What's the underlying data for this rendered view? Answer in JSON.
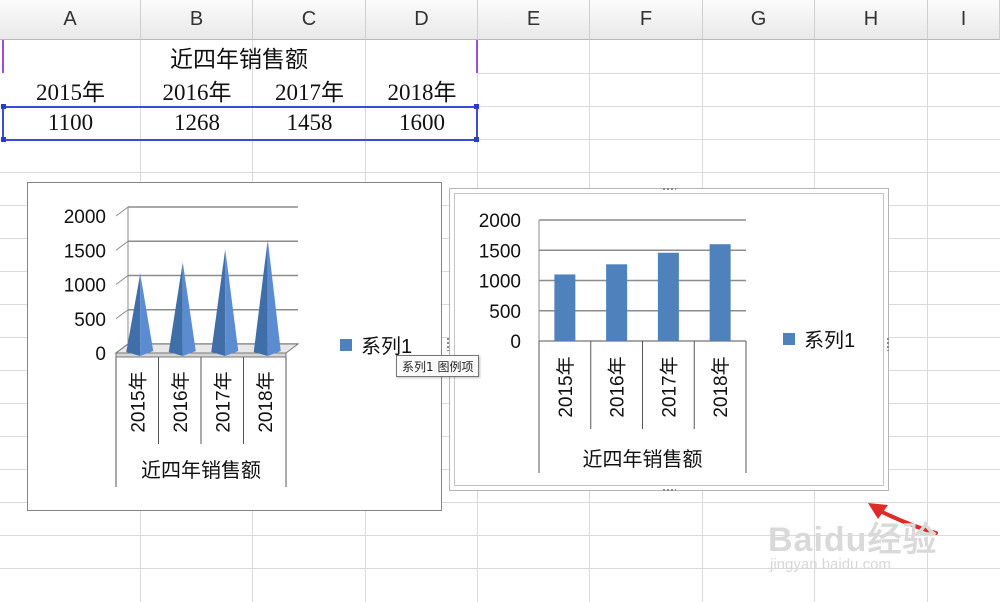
{
  "spreadsheet": {
    "columns": [
      "A",
      "B",
      "C",
      "D",
      "E",
      "F",
      "G",
      "H",
      "I"
    ],
    "table": {
      "title": "近四年销售额",
      "years": [
        "2015年",
        "2016年",
        "2017年",
        "2018年"
      ],
      "values": [
        "1100",
        "1268",
        "1458",
        "1600"
      ]
    },
    "selection_color": "#3a4bd6"
  },
  "chart_data": [
    {
      "type": "bar",
      "style": "3d-cone",
      "categories": [
        "2015年",
        "2016年",
        "2017年",
        "2018年"
      ],
      "category_group_label": "近四年销售额",
      "series": [
        {
          "name": "系列1",
          "values": [
            1100,
            1268,
            1458,
            1600
          ]
        }
      ],
      "y_ticks": [
        "2000",
        "1500",
        "1000",
        "500",
        "0"
      ],
      "ylim": [
        0,
        2000
      ],
      "grid": true,
      "legend": "right",
      "color": "#4f81bd"
    },
    {
      "type": "bar",
      "style": "clustered-column",
      "categories": [
        "2015年",
        "2016年",
        "2017年",
        "2018年"
      ],
      "category_group_label": "近四年销售额",
      "series": [
        {
          "name": "系列1",
          "values": [
            1100,
            1268,
            1458,
            1600
          ]
        }
      ],
      "y_ticks": [
        "2000",
        "1500",
        "1000",
        "500",
        "0"
      ],
      "ylim": [
        0,
        2000
      ],
      "grid": true,
      "legend": "right",
      "color": "#4f81bd"
    }
  ],
  "tooltip": {
    "text": "系列1 图例项"
  },
  "watermark": {
    "brand": "Baidu经验",
    "url": "jingyan.baidu.com"
  }
}
